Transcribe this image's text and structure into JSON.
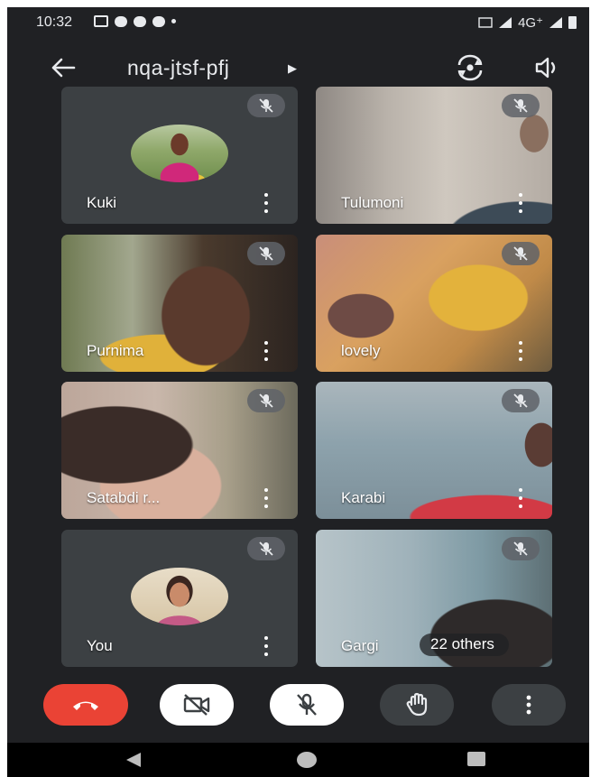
{
  "status_bar": {
    "time": "10:32",
    "network": "4G⁺"
  },
  "meeting": {
    "code": "nqa-jtsf-pfj"
  },
  "participants": [
    {
      "name": "Kuki"
    },
    {
      "name": "Tulumoni"
    },
    {
      "name": "Purnima"
    },
    {
      "name": "lovely"
    },
    {
      "name": "Satabdi r..."
    },
    {
      "name": "Karabi"
    },
    {
      "name": "You"
    },
    {
      "name": "Gargi"
    }
  ],
  "others_badge": "22 others",
  "colors": {
    "background": "#202124",
    "tile": "#3c4043",
    "leave": "#ea4335",
    "control_light": "#ffffff",
    "control_dark": "#3c4043"
  },
  "icons": {
    "back": "arrow-left-icon",
    "switch_camera": "switch-camera-icon",
    "audio_output": "speaker-icon",
    "muted": "mic-off-icon",
    "more": "more-vert-icon",
    "leave": "call-end-icon",
    "video_off": "video-off-icon",
    "mic_off": "mic-off-icon",
    "raise_hand": "hand-icon"
  }
}
